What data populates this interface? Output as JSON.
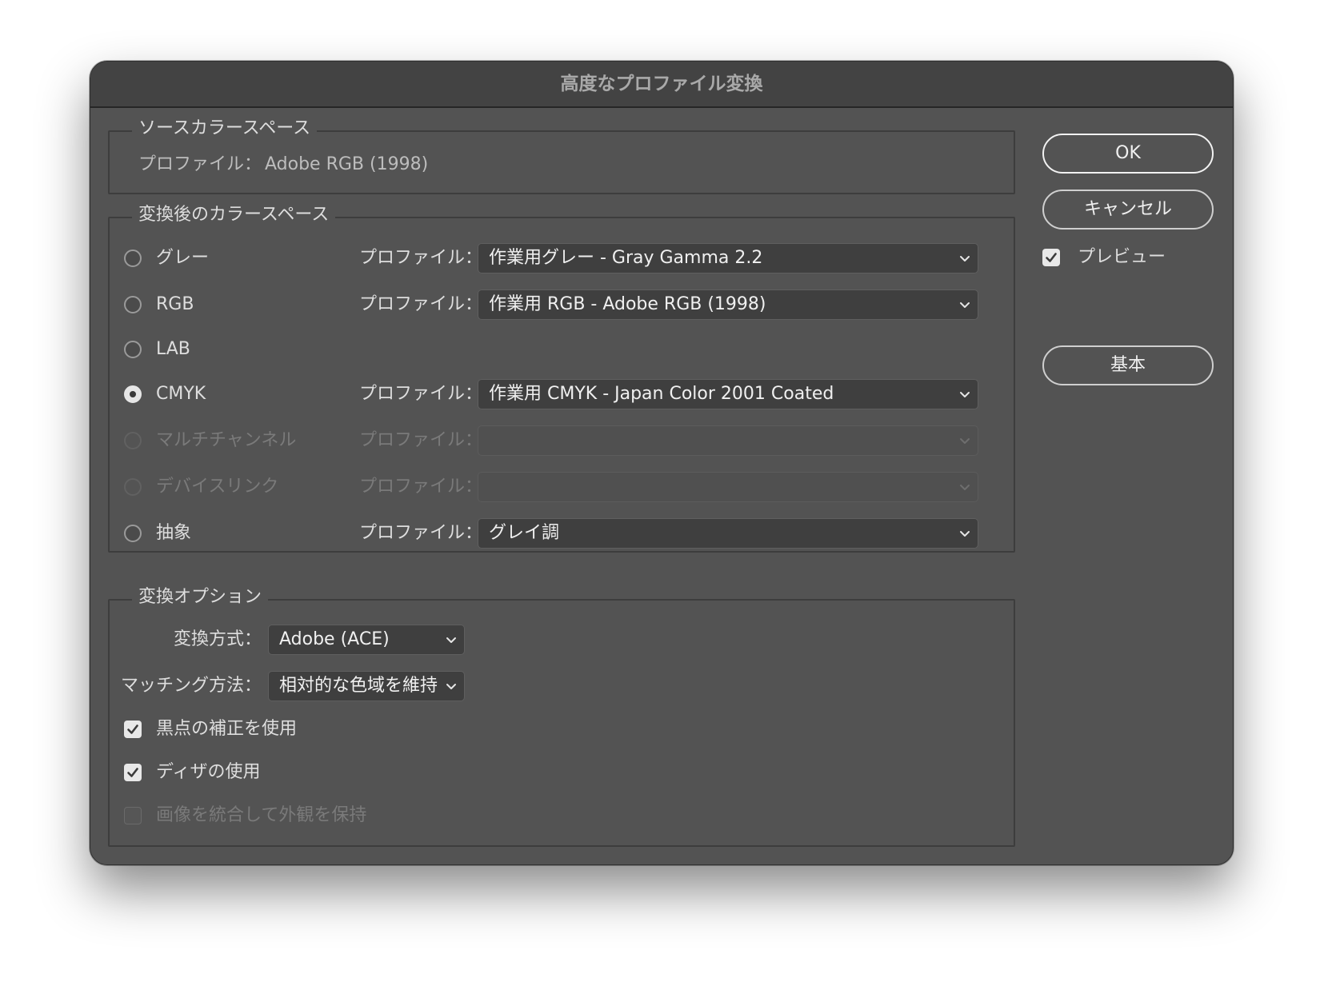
{
  "dialog": {
    "title": "高度なプロファイル変換"
  },
  "source": {
    "legend": "ソースカラースペース",
    "profile_label": "プロファイル：",
    "profile_value": "Adobe RGB (1998)"
  },
  "destination": {
    "legend": "変換後のカラースペース",
    "options": [
      {
        "label": "グレー",
        "profile_label": "プロファイル：",
        "profile_value": "作業用グレー - Gray Gamma 2.2",
        "selected": false,
        "enabled": true
      },
      {
        "label": "RGB",
        "profile_label": "プロファイル：",
        "profile_value": "作業用 RGB - Adobe RGB (1998)",
        "selected": false,
        "enabled": true
      },
      {
        "label": "LAB",
        "selected": false,
        "enabled": true
      },
      {
        "label": "CMYK",
        "profile_label": "プロファイル：",
        "profile_value": "作業用 CMYK - Japan Color 2001 Coated",
        "selected": true,
        "enabled": true
      },
      {
        "label": "マルチチャンネル",
        "profile_label": "プロファイル：",
        "profile_value": "",
        "selected": false,
        "enabled": false
      },
      {
        "label": "デバイスリンク",
        "profile_label": "プロファイル：",
        "profile_value": "",
        "selected": false,
        "enabled": false
      },
      {
        "label": "抽象",
        "profile_label": "プロファイル：",
        "profile_value": "グレイ調",
        "selected": false,
        "enabled": true
      }
    ]
  },
  "conversion": {
    "legend": "変換オプション",
    "engine_label": "変換方式：",
    "engine_value": "Adobe (ACE)",
    "intent_label": "マッチング方法：",
    "intent_value": "相対的な色域を維持",
    "checkboxes": [
      {
        "label": "黒点の補正を使用",
        "checked": true,
        "enabled": true
      },
      {
        "label": "ディザの使用",
        "checked": true,
        "enabled": true
      },
      {
        "label": "画像を統合して外観を保持",
        "checked": false,
        "enabled": false
      }
    ]
  },
  "buttons": {
    "ok": "OK",
    "cancel": "キャンセル",
    "basic": "基本"
  },
  "preview": {
    "label": "プレビュー",
    "checked": true
  },
  "icons": {
    "chevron": "chevron-down-icon",
    "check": "checkmark-icon"
  },
  "colors": {
    "dialog_bg": "#535353",
    "titlebar_bg": "#434343",
    "field_bg": "#3f3f3f",
    "text": "#dedede"
  }
}
